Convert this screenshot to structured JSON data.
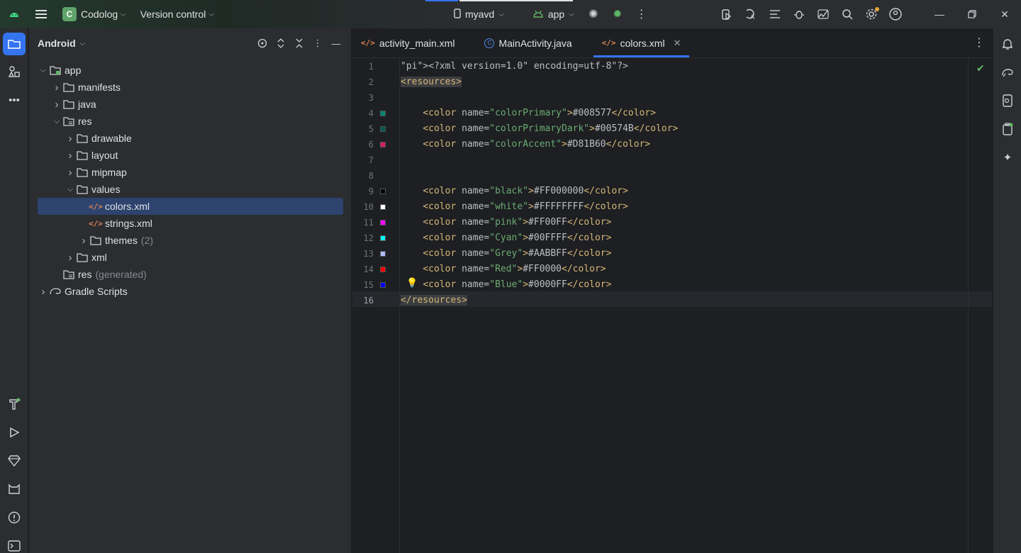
{
  "titlebar": {
    "project_initial": "C",
    "project_name": "Codolog",
    "version_control": "Version control",
    "device": "myavd",
    "run_config": "app"
  },
  "project_panel": {
    "view_mode": "Android",
    "tree": [
      {
        "label": "app",
        "depth": 0,
        "expanded": true,
        "type": "module"
      },
      {
        "label": "manifests",
        "depth": 1,
        "expanded": false,
        "type": "folder"
      },
      {
        "label": "java",
        "depth": 1,
        "expanded": false,
        "type": "folder"
      },
      {
        "label": "res",
        "depth": 1,
        "expanded": true,
        "type": "resfolder"
      },
      {
        "label": "drawable",
        "depth": 2,
        "expanded": false,
        "type": "folder"
      },
      {
        "label": "layout",
        "depth": 2,
        "expanded": false,
        "type": "folder"
      },
      {
        "label": "mipmap",
        "depth": 2,
        "expanded": false,
        "type": "folder"
      },
      {
        "label": "values",
        "depth": 2,
        "expanded": true,
        "type": "folder"
      },
      {
        "label": "colors.xml",
        "depth": 3,
        "type": "xml",
        "selected": true
      },
      {
        "label": "strings.xml",
        "depth": 3,
        "type": "xml"
      },
      {
        "label": "themes",
        "suffix": "(2)",
        "depth": 3,
        "expanded": false,
        "type": "folder"
      },
      {
        "label": "xml",
        "depth": 2,
        "expanded": false,
        "type": "folder"
      },
      {
        "label": "res",
        "suffix": "(generated)",
        "depth": 1,
        "type": "resfolder"
      },
      {
        "label": "Gradle Scripts",
        "depth": 0,
        "expanded": false,
        "type": "gradle"
      }
    ]
  },
  "editor": {
    "tabs": [
      {
        "label": "activity_main.xml",
        "icon": "xml-icon",
        "active": false
      },
      {
        "label": "MainActivity.java",
        "icon": "java-class-icon",
        "active": false
      },
      {
        "label": "colors.xml",
        "icon": "xml-icon",
        "active": true
      }
    ],
    "lines": [
      {
        "n": "1",
        "text": "<?xml version=\"1.0\" encoding=\"utf-8\"?>"
      },
      {
        "n": "2",
        "text": "<resources>"
      },
      {
        "n": "3",
        "text": ""
      },
      {
        "n": "4",
        "text": "    <color name=\"colorPrimary\">#008577</color>",
        "swatch": "#008577"
      },
      {
        "n": "5",
        "text": "    <color name=\"colorPrimaryDark\">#00574B</color>",
        "swatch": "#00574B"
      },
      {
        "n": "6",
        "text": "    <color name=\"colorAccent\">#D81B60</color>",
        "swatch": "#D81B60"
      },
      {
        "n": "7",
        "text": ""
      },
      {
        "n": "8",
        "text": ""
      },
      {
        "n": "9",
        "text": "    <color name=\"black\">#FF000000</color>",
        "swatch": "#000000"
      },
      {
        "n": "10",
        "text": "    <color name=\"white\">#FFFFFFFF</color>",
        "swatch": "#FFFFFF"
      },
      {
        "n": "11",
        "text": "    <color name=\"pink\">#FF00FF</color>",
        "swatch": "#FF00FF"
      },
      {
        "n": "12",
        "text": "    <color name=\"Cyan\">#00FFFF</color>",
        "swatch": "#00FFFF"
      },
      {
        "n": "13",
        "text": "    <color name=\"Grey\">#AABBFF</color>",
        "swatch": "#AABBFF"
      },
      {
        "n": "14",
        "text": "    <color name=\"Red\">#FF0000</color>",
        "swatch": "#FF0000"
      },
      {
        "n": "15",
        "text": "    <color name=\"Blue\">#0000FF</color>",
        "swatch": "#0000FF"
      },
      {
        "n": "16",
        "text": "</resources>"
      }
    ],
    "current_line": "16"
  },
  "colors": {
    "accent": "#3574f0",
    "selection": "#2e436e"
  }
}
